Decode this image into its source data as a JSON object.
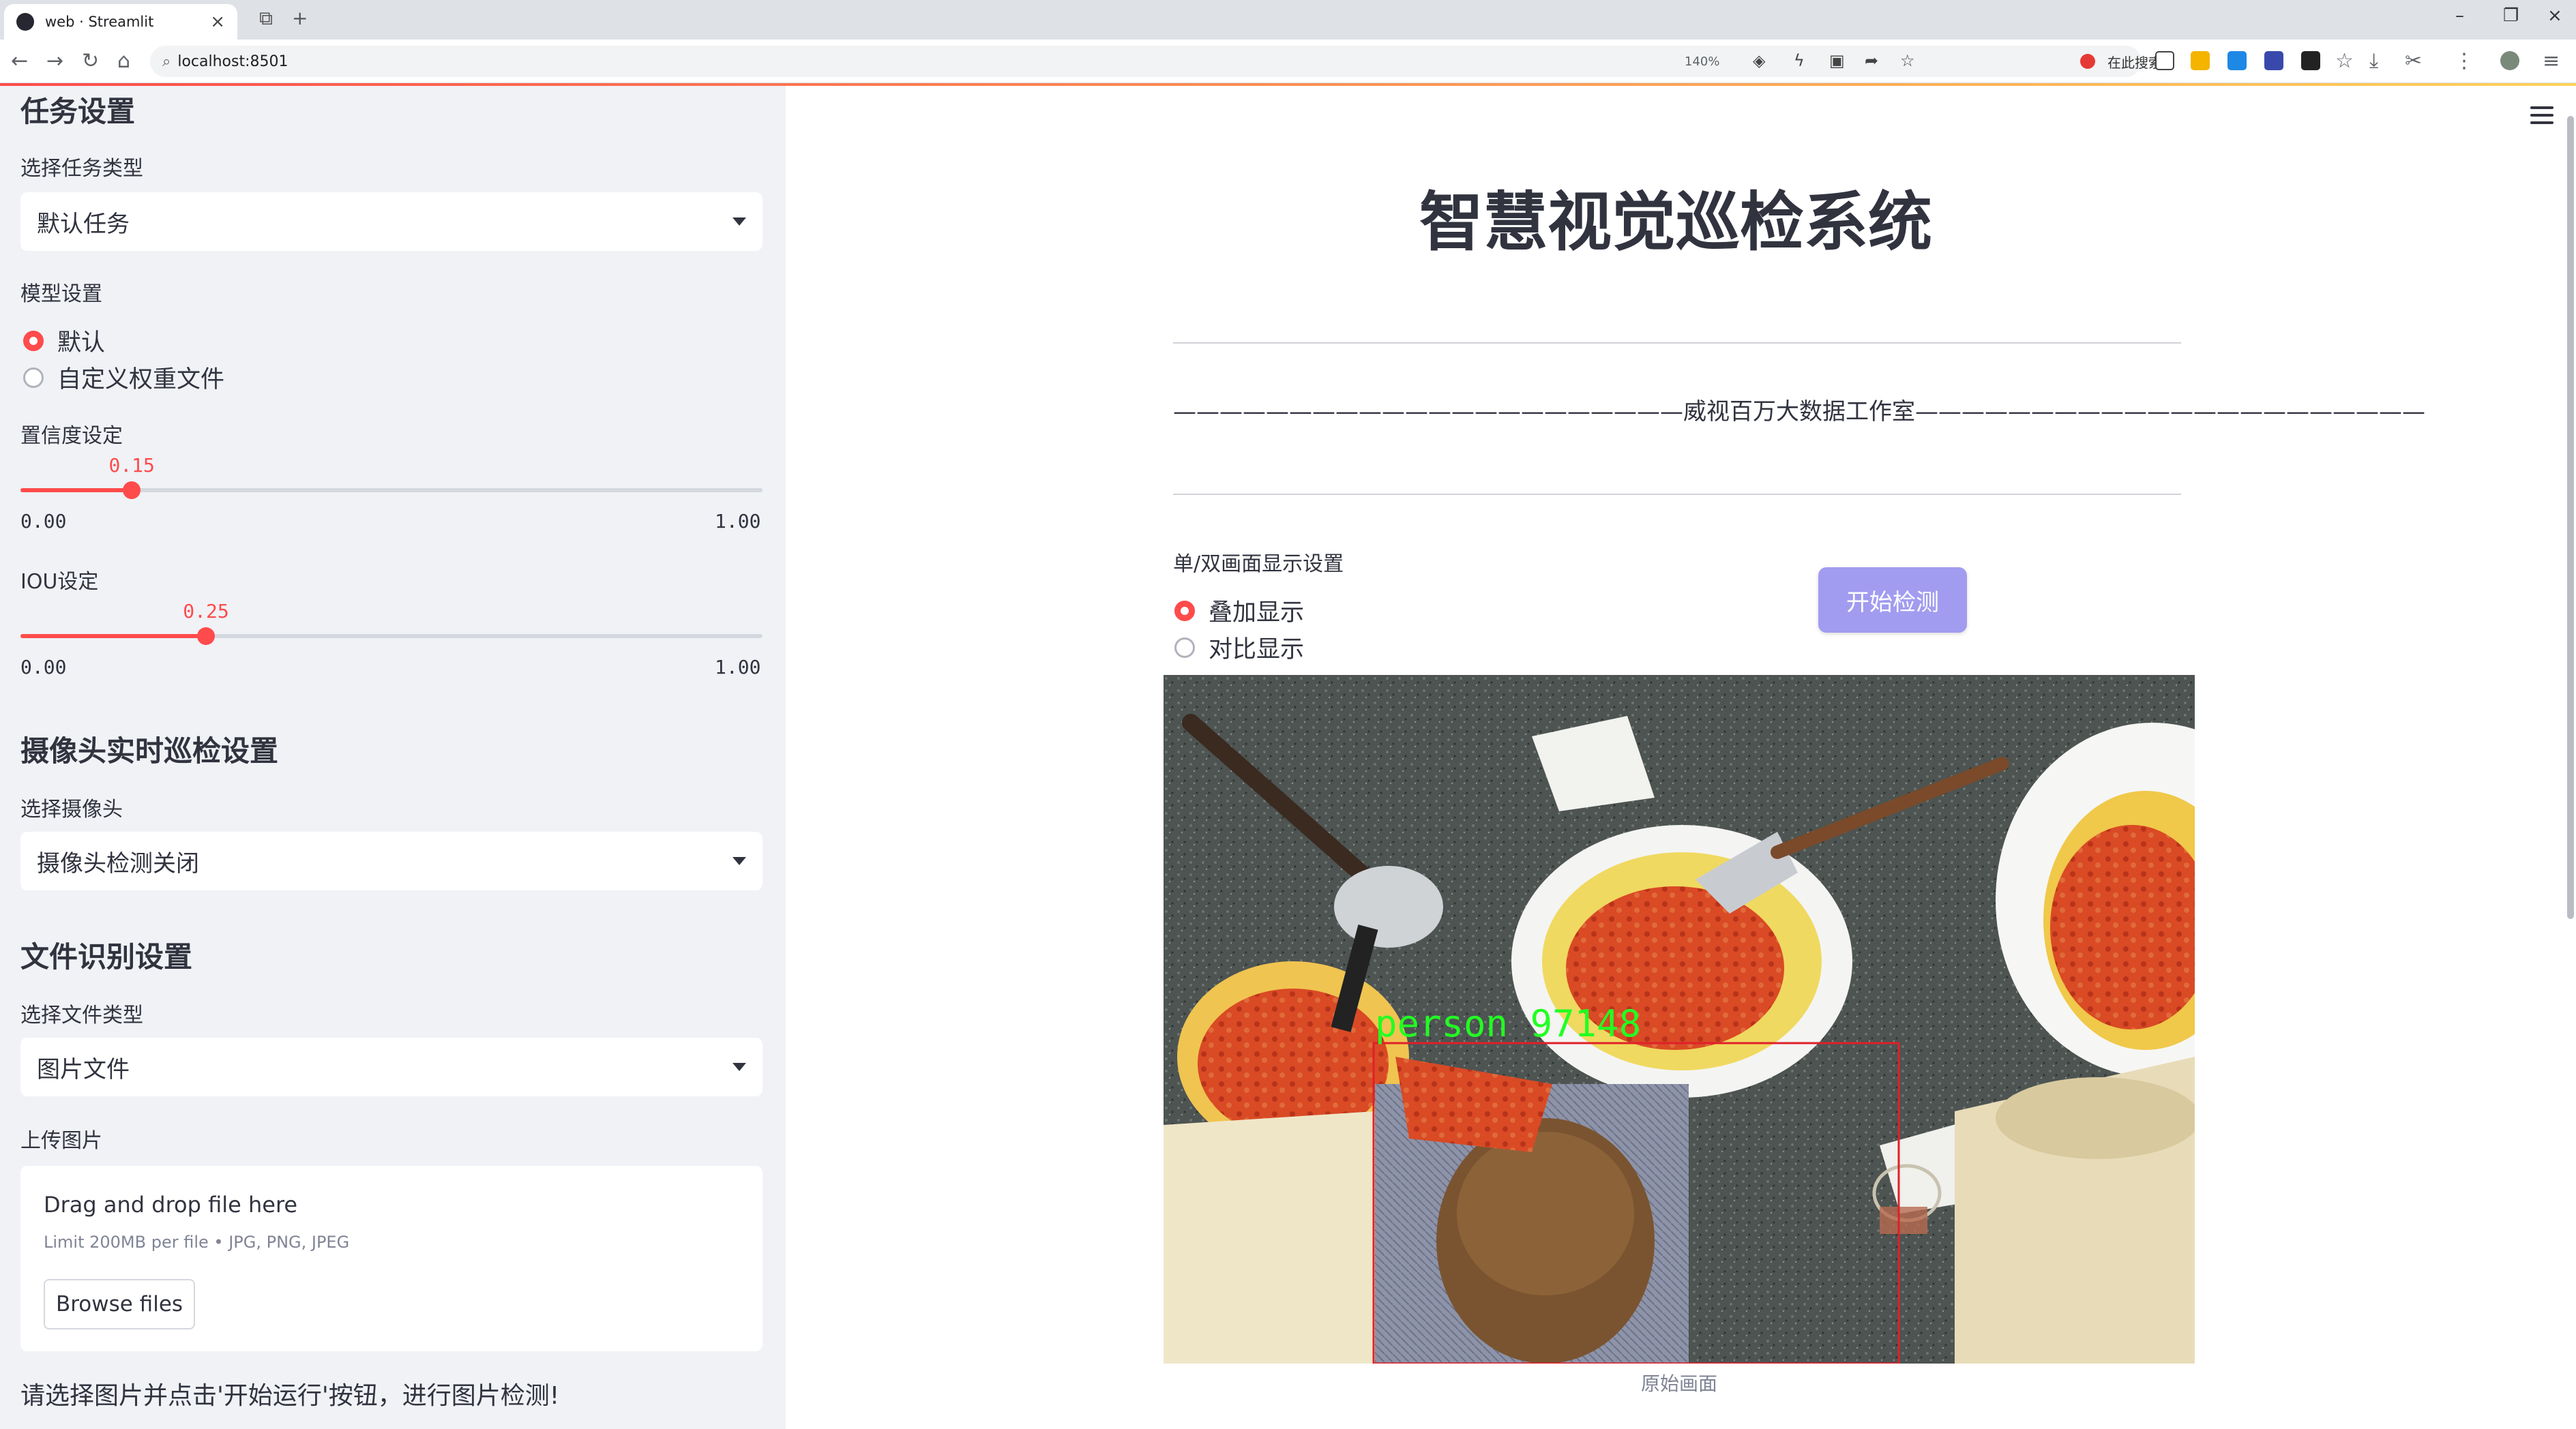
{
  "browser": {
    "tab_title": "web · Streamlit",
    "url": "localhost:8501",
    "zoom": "140%",
    "search_placeholder": "在此搜索"
  },
  "sidebar": {
    "task_section": {
      "heading": "任务设置",
      "task_type_label": "选择任务类型",
      "task_type_value": "默认任务"
    },
    "model": {
      "label": "模型设置",
      "options": [
        "默认",
        "自定义权重文件"
      ],
      "selected": "默认"
    },
    "confidence": {
      "label": "置信度设定",
      "value": "0.15",
      "min": "0.00",
      "max": "1.00",
      "fraction": 0.15
    },
    "iou": {
      "label": "IOU设定",
      "value": "0.25",
      "min": "0.00",
      "max": "1.00",
      "fraction": 0.25
    },
    "camera_section": {
      "heading": "摄像头实时巡检设置",
      "camera_label": "选择摄像头",
      "camera_value": "摄像头检测关闭"
    },
    "file_section": {
      "heading": "文件识别设置",
      "file_type_label": "选择文件类型",
      "file_type_value": "图片文件",
      "upload_label": "上传图片",
      "drag_drop": "Drag and drop file here",
      "limit": "Limit 200MB per file • JPG, PNG, JPEG",
      "browse": "Browse files"
    },
    "hint": "请选择图片并点击'开始运行'按钮，进行图片检测!"
  },
  "main": {
    "title": "智慧视觉巡检系统",
    "subtitle": "——————————————————————威视百万大数据工作室——————————————————————",
    "display_mode": {
      "label": "单/双画面显示设置",
      "options": [
        "叠加显示",
        "对比显示"
      ],
      "selected": "叠加显示"
    },
    "start_button": "开始检测",
    "detection_label": "person  97148",
    "image_caption": "原始画面"
  },
  "colors": {
    "accent": "#ff4b4b",
    "sidebar_bg": "#f0f2f6",
    "button": "#a29cf0",
    "detection_box": "#e0202a",
    "detection_text": "#22ff22"
  }
}
